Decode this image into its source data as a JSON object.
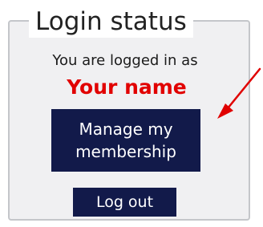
{
  "login_status": {
    "title": "Login status",
    "status_text": "You are logged in as",
    "user_name": "Your name",
    "manage_button_label": "Manage my membership",
    "logout_button_label": "Log out"
  },
  "annotation": {
    "arrow_color": "#e00000"
  },
  "colors": {
    "button_bg": "#121a4a",
    "button_text": "#ffffff",
    "user_name": "#e10000",
    "panel_bg": "#f0f0f2",
    "panel_border": "#c4c6ca"
  }
}
